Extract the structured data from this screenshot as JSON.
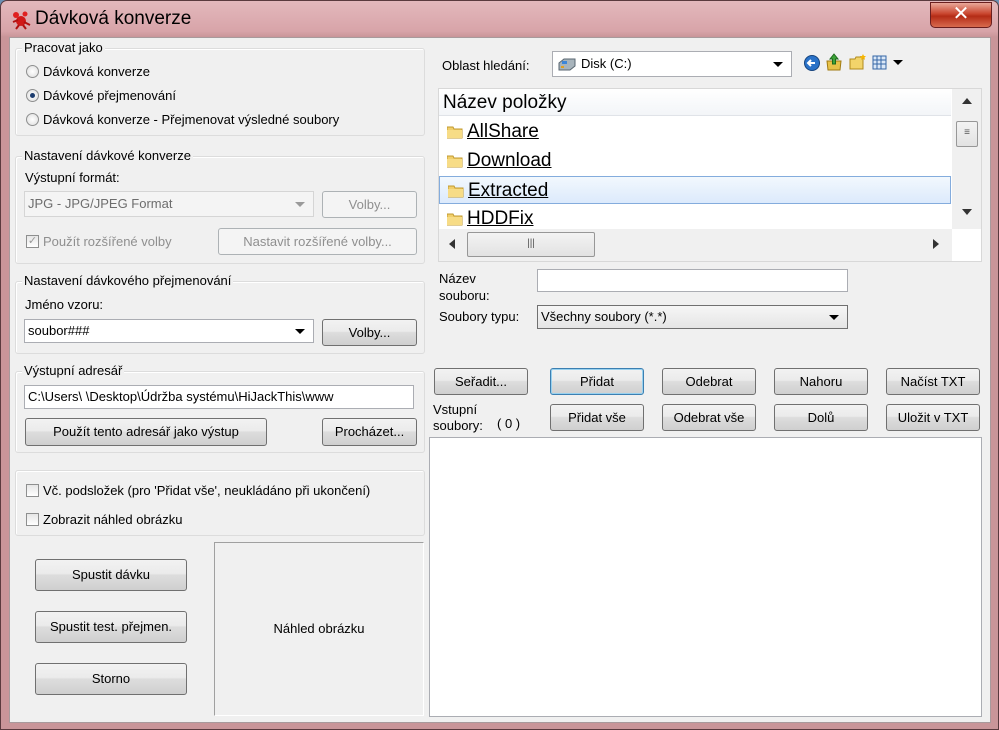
{
  "window": {
    "title": "Dávková konverze",
    "close_glyph": "✕"
  },
  "work_as": {
    "title": "Pracovat jako",
    "options": [
      {
        "label": "Dávková konverze",
        "selected": false
      },
      {
        "label": "Dávkové přejmenování",
        "selected": true
      },
      {
        "label": "Dávková konverze - Přejmenovat výsledné soubory",
        "selected": false
      }
    ]
  },
  "conversion": {
    "title": "Nastavení dávkové konverze",
    "format_label": "Výstupní formát:",
    "format_value": "JPG - JPG/JPEG Format",
    "options_button": "Volby...",
    "advanced_check": "Použít rozšířené volby",
    "advanced_checked": true,
    "advanced_button": "Nastavit rozšířené volby..."
  },
  "rename": {
    "title": "Nastavení dávkového přejmenování",
    "pattern_label": "Jméno vzoru:",
    "pattern_value": "soubor###",
    "options_button": "Volby..."
  },
  "output": {
    "title": "Výstupní adresář",
    "path": "C:\\Users\\          \\Desktop\\Údržba systému\\HiJackThis\\www",
    "use_dir_button": "Použít tento adresář jako výstup",
    "browse_button": "Procházet..."
  },
  "checks": {
    "subfolders": "Vč. podsložek (pro 'Přidat vše', neukládáno při ukončení)",
    "subfolders_checked": false,
    "preview": "Zobrazit náhled obrázku",
    "preview_checked": false
  },
  "actions": {
    "start": "Spustit dávku",
    "test": "Spustit test. přejmen.",
    "cancel": "Storno"
  },
  "preview_box": {
    "label": "Náhled obrázku"
  },
  "browser": {
    "search_label": "Oblast hledání:",
    "location": "Disk (C:)",
    "column_header": "Název položky",
    "items": [
      {
        "name": "AllShare",
        "selected": false
      },
      {
        "name": "Download",
        "selected": false
      },
      {
        "name": "Extracted",
        "selected": true
      },
      {
        "name": "HDDFix",
        "selected": false
      }
    ],
    "filename_label_1": "Název",
    "filename_label_2": "souboru:",
    "filename_value": "",
    "filetype_label": "Soubory typu:",
    "filetype_value": "Všechny soubory (*.*)"
  },
  "input_files": {
    "label_1": "Vstupní",
    "label_2": "soubory:",
    "count": "( 0 )",
    "buttons": {
      "sort": "Seřadit...",
      "add": "Přidat",
      "remove": "Odebrat",
      "up": "Nahoru",
      "load_txt": "Načíst TXT",
      "add_all": "Přidat vše",
      "remove_all": "Odebrat vše",
      "down": "Dolů",
      "save_txt": "Uložit v TXT"
    }
  },
  "colors": {
    "title_bar": "#d8a4a9",
    "close_button": "#c9452e",
    "selection": "#dceafc",
    "client": "#f0f0f0"
  }
}
